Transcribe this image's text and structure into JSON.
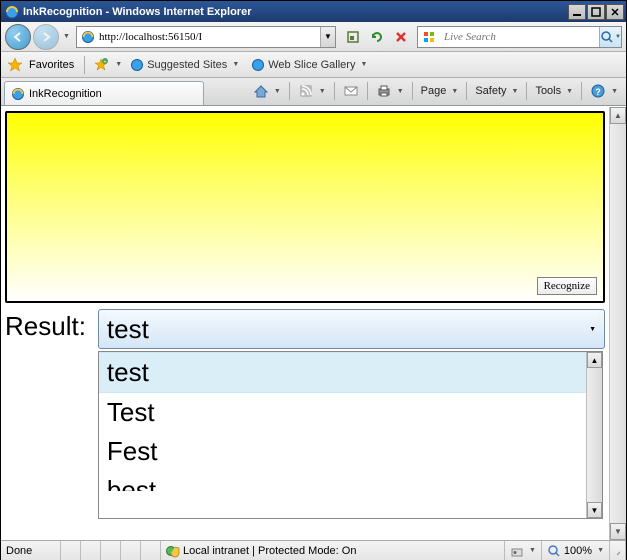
{
  "window": {
    "title": "InkRecognition - Windows Internet Explorer"
  },
  "nav": {
    "url": "http://localhost:56150/I",
    "search_placeholder": "Live Search"
  },
  "links_bar": {
    "favorites": "Favorites",
    "suggested": "Suggested Sites",
    "webslice": "Web Slice Gallery"
  },
  "tab": {
    "title": "InkRecognition"
  },
  "command_bar": {
    "page": "Page",
    "safety": "Safety",
    "tools": "Tools"
  },
  "page": {
    "recognize_label": "Recognize",
    "result_label": "Result:",
    "combo_selected": "test",
    "dropdown_items": [
      "test",
      "Test",
      "Fest",
      "best"
    ]
  },
  "status": {
    "left": "Done",
    "zone": "Local intranet | Protected Mode: On",
    "zoom": "100%"
  },
  "icons": {
    "ie": "ie",
    "star": "★"
  }
}
